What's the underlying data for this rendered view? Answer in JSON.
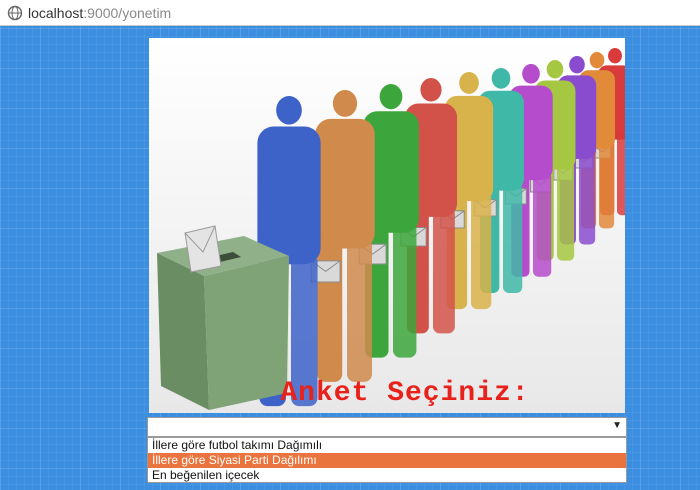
{
  "browser": {
    "url_host": "localhost",
    "url_path": ":9000/yonetim"
  },
  "banner": {
    "title": "Anket Seçiniz:",
    "figure_colors": [
      "#3d63c9",
      "#cf8a4c",
      "#3ca63c",
      "#d2524a",
      "#d8b24a",
      "#3fb8a7",
      "#b54ccc",
      "#a6c742",
      "#8a4ccf",
      "#e08a3a",
      "#d93a3a"
    ]
  },
  "survey_select": {
    "selected_value": "",
    "options": [
      "İllere göre futbol takımı Dağımılı",
      "İllere göre Siyasi Parti Dağılımı",
      "En beğenilen içecek"
    ],
    "highlighted_index": 1
  }
}
